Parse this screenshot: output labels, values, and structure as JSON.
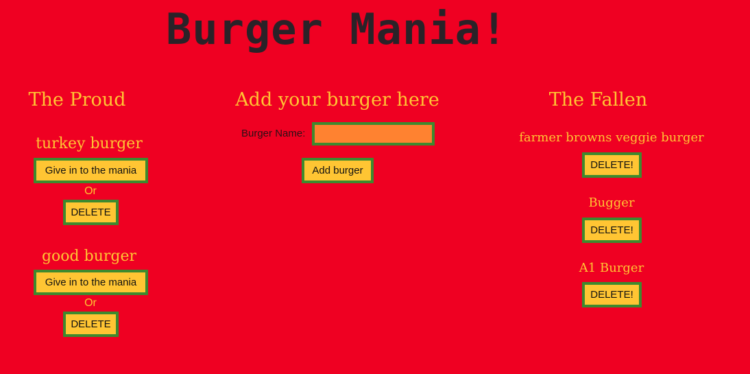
{
  "title": "Burger Mania!",
  "proud": {
    "heading": "The Proud",
    "items": [
      {
        "name": "turkey burger",
        "devour_label": "Give in to the mania",
        "or_label": "Or",
        "delete_label": "DELETE"
      },
      {
        "name": "good burger",
        "devour_label": "Give in to the mania",
        "or_label": "Or",
        "delete_label": "DELETE"
      }
    ]
  },
  "add": {
    "heading": "Add your burger here",
    "name_label": "Burger Name:",
    "name_value": "",
    "button_label": "Add burger"
  },
  "fallen": {
    "heading": "The Fallen",
    "items": [
      {
        "name": "farmer browns veggie burger",
        "delete_label": "DELETE!"
      },
      {
        "name": "Bugger",
        "delete_label": "DELETE!"
      },
      {
        "name": "A1 Burger",
        "delete_label": "DELETE!"
      }
    ]
  }
}
